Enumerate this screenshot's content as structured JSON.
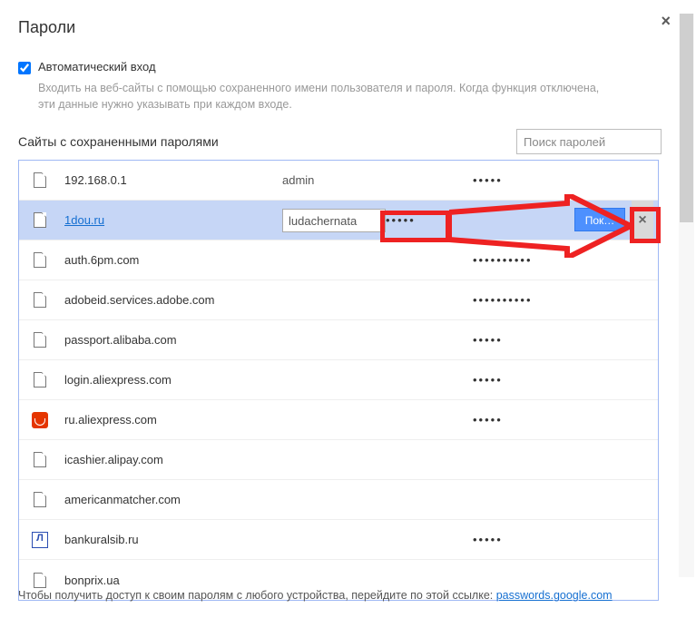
{
  "dialog": {
    "title": "Пароли",
    "close_glyph": "×"
  },
  "auto_signin": {
    "label": "Автоматический вход",
    "hint": "Входить на веб-сайты с помощью сохраненного имени пользователя и пароля. Когда функция отключена, эти данные нужно указывать при каждом входе."
  },
  "saved": {
    "heading": "Сайты с сохраненными паролями",
    "search_placeholder": "Поиск паролей"
  },
  "rows": [
    {
      "icon": "file",
      "site": "192.168.0.1",
      "user": "admin",
      "pw": "•••••",
      "selected": false
    },
    {
      "icon": "file",
      "site": "1dou.ru",
      "user": "ludachernata",
      "pw": "•••••",
      "selected": true,
      "reveal": "Пок…"
    },
    {
      "icon": "file",
      "site": "auth.6pm.com",
      "user": "",
      "pw": "••••••••••",
      "selected": false
    },
    {
      "icon": "file",
      "site": "adobeid.services.adobe.com",
      "user": "",
      "pw": "••••••••••",
      "selected": false
    },
    {
      "icon": "file",
      "site": "passport.alibaba.com",
      "user": "",
      "pw": "•••••",
      "selected": false
    },
    {
      "icon": "file",
      "site": "login.aliexpress.com",
      "user": "",
      "pw": "•••••",
      "selected": false
    },
    {
      "icon": "ali",
      "site": "ru.aliexpress.com",
      "user": "",
      "pw": "•••••",
      "selected": false
    },
    {
      "icon": "file",
      "site": "icashier.alipay.com",
      "user": "",
      "pw": "",
      "selected": false
    },
    {
      "icon": "file",
      "site": "americanmatcher.com",
      "user": "",
      "pw": "",
      "selected": false
    },
    {
      "icon": "bank",
      "site": "bankuralsib.ru",
      "user": "",
      "pw": "•••••",
      "selected": false
    },
    {
      "icon": "file",
      "site": "bonprix.ua",
      "user": "",
      "pw": "",
      "selected": false
    }
  ],
  "footer": {
    "hint": "Чтобы получить доступ к своим паролям с любого устройства, перейдите по этой ссылке: ",
    "link_text": "passwords.google.com"
  }
}
